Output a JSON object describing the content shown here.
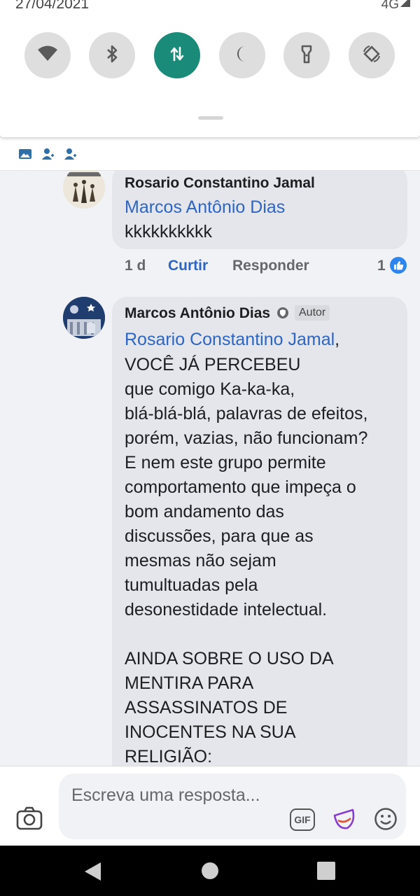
{
  "status_bar": {
    "date": "27/04/2021",
    "network": "4G"
  },
  "quick_settings": [
    "wifi-icon",
    "bluetooth-icon",
    "mobile-data-icon",
    "do-not-disturb-icon",
    "flashlight-icon",
    "auto-rotate-icon"
  ],
  "colors": {
    "accent": "#1a8a79",
    "link": "#2d65c2",
    "bubble": "#e4e6eb",
    "background": "#f0f2f5"
  },
  "comments": [
    {
      "author": "Rosario Constantino Jamal",
      "mention": "Marcos Antônio Dias",
      "text": "kkkkkkkkkk",
      "time": "1 d",
      "like_label": "Curtir",
      "reply_label": "Responder",
      "reaction_count": "1"
    },
    {
      "author": "Marcos Antônio Dias",
      "badge": "Autor",
      "mention": "Rosario Constantino Jamal",
      "mention_suffix": ",",
      "text": "VOCÊ JÁ PERCEBEU\nque comigo Ka-ka-ka,\nblá-blá-blá, palavras de efeitos,\nporém, vazias, não funcionam?\nE nem este grupo permite\ncomportamento que impeça o\nbom andamento das\ndiscussões, para que as\nmesmas não sejam\ntumultuadas pela\ndesonestidade intelectual.\n\nAINDA SOBRE O USO DA\nMENTIRA PARA\nASSASSINATOS DE\nINOCENTES NA SUA\nRELIGIÃO:"
    }
  ],
  "composer": {
    "placeholder": "Escreva uma resposta...",
    "gif_label": "GIF"
  }
}
